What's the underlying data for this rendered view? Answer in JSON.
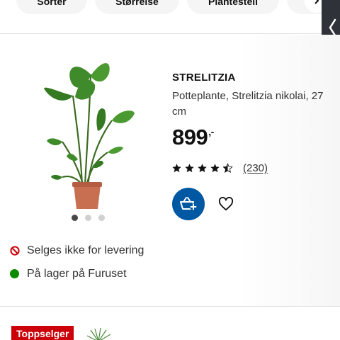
{
  "filters": {
    "chips": [
      {
        "label": "Sorter"
      },
      {
        "label": "Størrelse"
      },
      {
        "label": "Plantestell"
      }
    ]
  },
  "product": {
    "name": "STRELITZIA",
    "description": "Potteplante, Strelitzia nikolai, 27 cm",
    "price": "899",
    "price_suffix": ",-",
    "rating": 4.5,
    "rating_max": 5,
    "reviews": "(230)",
    "image_count": 3,
    "active_image": 1
  },
  "availability": {
    "delivery_text": "Selges ikke for levering",
    "stock_text": "På lager på Furuset"
  },
  "next_product": {
    "badge": "Toppselger"
  },
  "colors": {
    "brand_blue": "#0058a3",
    "unavailable_red": "#cc0008",
    "in_stock_green": "#0a8a00",
    "badge_red": "#cc0008"
  }
}
